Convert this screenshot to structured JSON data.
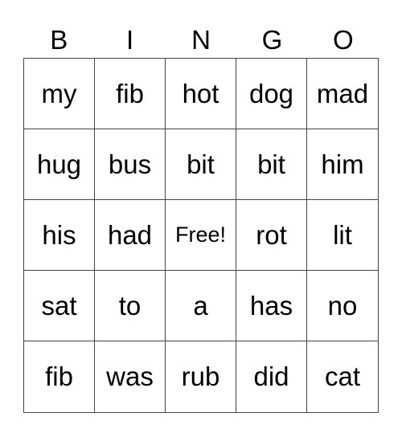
{
  "header": [
    "B",
    "I",
    "N",
    "G",
    "O"
  ],
  "rows": [
    [
      "my",
      "fib",
      "hot",
      "dog",
      "mad"
    ],
    [
      "hug",
      "bus",
      "bit",
      "bit",
      "him"
    ],
    [
      "his",
      "had",
      "Free!",
      "rot",
      "lit"
    ],
    [
      "sat",
      "to",
      "a",
      "has",
      "no"
    ],
    [
      "fib",
      "was",
      "rub",
      "did",
      "cat"
    ]
  ]
}
